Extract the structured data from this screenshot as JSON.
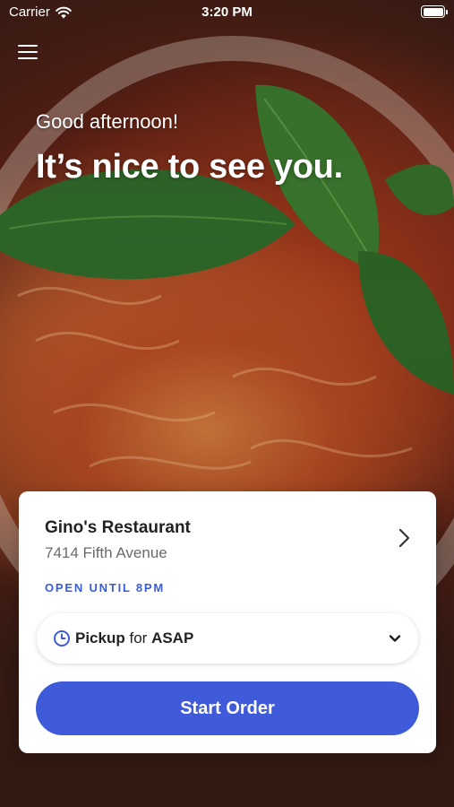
{
  "status_bar": {
    "carrier": "Carrier",
    "time": "3:20 PM"
  },
  "hero": {
    "greeting": "Good afternoon!",
    "headline": "It’s nice to see you."
  },
  "restaurant": {
    "name": "Gino's Restaurant",
    "address": "7414 Fifth Avenue",
    "open_status": "OPEN UNTIL 8PM"
  },
  "order_mode": {
    "mode": "Pickup",
    "connector": "for",
    "time": "ASAP"
  },
  "actions": {
    "start_order_label": "Start Order"
  },
  "colors": {
    "accent": "#3f5bd9",
    "open_status": "#3a5bd9"
  },
  "icons": {
    "menu": "hamburger-menu-icon",
    "navigate": "chevron-right-icon",
    "clock": "clock-icon",
    "dropdown": "chevron-down-icon",
    "wifi": "wifi-icon",
    "battery": "battery-icon"
  }
}
